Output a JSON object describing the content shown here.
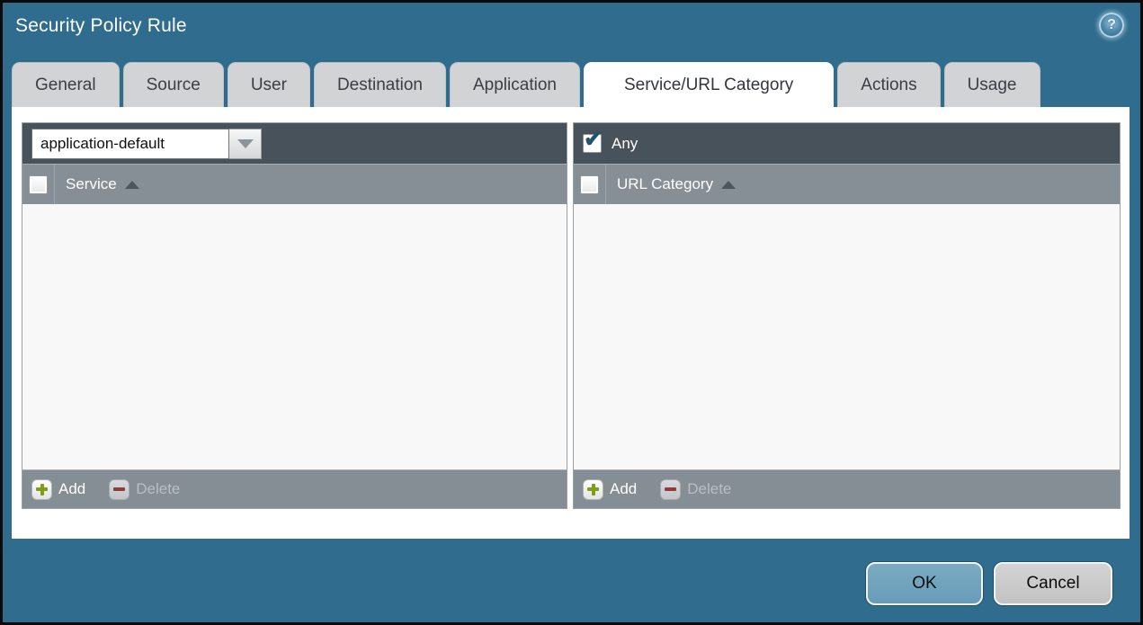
{
  "dialog": {
    "title": "Security Policy Rule"
  },
  "tabs": [
    {
      "label": "General",
      "active": false
    },
    {
      "label": "Source",
      "active": false
    },
    {
      "label": "User",
      "active": false
    },
    {
      "label": "Destination",
      "active": false
    },
    {
      "label": "Application",
      "active": false
    },
    {
      "label": "Service/URL Category",
      "active": true
    },
    {
      "label": "Actions",
      "active": false
    },
    {
      "label": "Usage",
      "active": false
    }
  ],
  "service_panel": {
    "dropdown_value": "application-default",
    "select_all_checked": false,
    "column_header": "Service",
    "rows": [],
    "add_label": "Add",
    "delete_label": "Delete",
    "delete_enabled": false
  },
  "url_panel": {
    "any_label": "Any",
    "any_checked": true,
    "checkmark_glyph": "✔",
    "select_all_checked": false,
    "column_header": "URL Category",
    "rows": [],
    "add_label": "Add",
    "delete_label": "Delete",
    "delete_enabled": false
  },
  "footer": {
    "ok_label": "OK",
    "cancel_label": "Cancel"
  },
  "icons": {
    "help": "?",
    "sort": "ascending-triangle",
    "dropdown": "down-triangle",
    "add": "green-plus",
    "delete": "red-minus"
  },
  "colors": {
    "dialog_background": "#2f6c8d",
    "panel_toolbar": "#47525b",
    "panel_header": "#868e96",
    "panel_footer": "#858d95",
    "tab_inactive": "#d2d3d4",
    "tab_active": "#ffffff",
    "ok_button": "#6fa2bd",
    "cancel_button": "#c9c9c9",
    "add_plus": "#7f9c1c",
    "delete_minus": "#8f3e3e",
    "checkmark": "#23536e"
  }
}
